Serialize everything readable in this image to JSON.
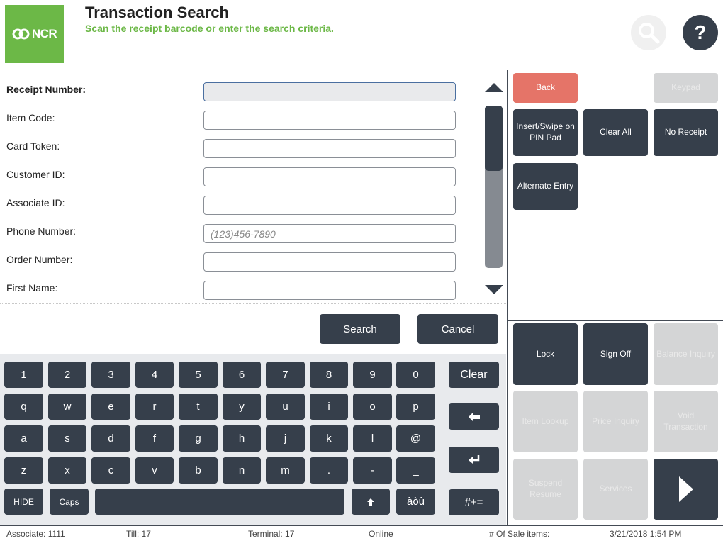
{
  "header": {
    "logo_text": "NCR",
    "title": "Transaction Search",
    "subtitle": "Scan the receipt barcode or enter the search criteria.",
    "help_symbol": "?"
  },
  "form": {
    "fields": [
      {
        "label": "Receipt Number:",
        "value": "",
        "placeholder": ""
      },
      {
        "label": "Item Code:",
        "value": "",
        "placeholder": ""
      },
      {
        "label": "Card Token:",
        "value": "",
        "placeholder": ""
      },
      {
        "label": "Customer ID:",
        "value": "",
        "placeholder": ""
      },
      {
        "label": "Associate ID:",
        "value": "",
        "placeholder": ""
      },
      {
        "label": "Phone Number:",
        "value": "",
        "placeholder": "(123)456-7890"
      },
      {
        "label": "Order Number:",
        "value": "",
        "placeholder": ""
      },
      {
        "label": "First Name:",
        "value": "",
        "placeholder": ""
      }
    ],
    "search_label": "Search",
    "cancel_label": "Cancel"
  },
  "keyboard": {
    "row1": [
      "1",
      "2",
      "3",
      "4",
      "5",
      "6",
      "7",
      "8",
      "9",
      "0"
    ],
    "row2": [
      "q",
      "w",
      "e",
      "r",
      "t",
      "y",
      "u",
      "i",
      "o",
      "p"
    ],
    "row3": [
      "a",
      "s",
      "d",
      "f",
      "g",
      "h",
      "j",
      "k",
      "l",
      "@"
    ],
    "row4": [
      "z",
      "x",
      "c",
      "v",
      "b",
      "n",
      "m",
      ".",
      "-",
      "_"
    ],
    "hide_label": "HIDE",
    "caps_label": "Caps",
    "shift_symbol": "🠉",
    "accents_label": "àòù",
    "clear_label": "Clear",
    "backspace_symbol": "🡄",
    "enter_symbol": "↵",
    "symbols_label": "#+="
  },
  "right_panel": {
    "top": {
      "back": "Back",
      "keypad": "Keypad",
      "insert_swipe": "Insert/Swipe on PIN Pad",
      "clear_all": "Clear All",
      "no_receipt": "No Receipt",
      "alternate_entry": "Alternate Entry"
    },
    "bottom": {
      "lock": "Lock",
      "sign_off": "Sign Off",
      "balance_inquiry": "Balance Inquiry",
      "item_lookup": "Item Lookup",
      "price_inquiry": "Price Inquiry",
      "void_transaction": "Void Transaction",
      "suspend_resume": "Suspend Resume",
      "services": "Services",
      "next_symbol": "▶"
    }
  },
  "footer": {
    "associate": "Associate: 1111",
    "till": "Till: 17",
    "terminal": "Terminal: 17",
    "status": "Online",
    "sale_items": "# Of Sale items:",
    "datetime": "3/21/2018 1:54 PM"
  },
  "colors": {
    "brand_green": "#6cb847",
    "dark_button": "#363f4b",
    "back_red": "#e57468",
    "disabled": "#d4d5d6"
  }
}
